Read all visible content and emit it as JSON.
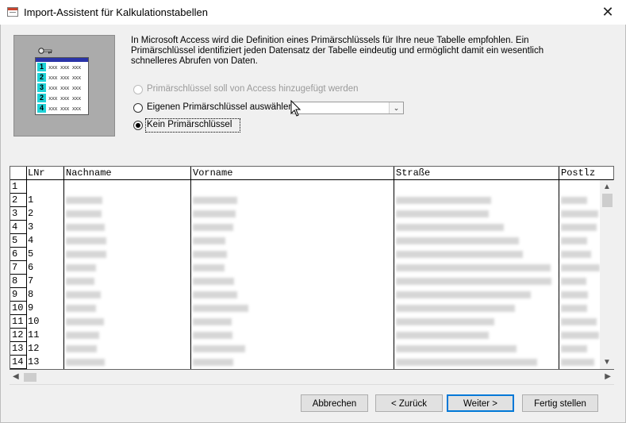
{
  "window": {
    "title": "Import-Assistent für Kalkulationstabellen",
    "close_glyph": "✕"
  },
  "illustration": {
    "row_numbers": [
      "1",
      "2",
      "3",
      "2",
      "4"
    ],
    "cell_text": "xxx xxx xxx"
  },
  "description": "In Microsoft Access wird die Definition eines Primärschlüssels für Ihre neue Tabelle empfohlen. Ein Primärschlüssel identifiziert jeden Datensatz der Tabelle eindeutig und ermöglicht damit ein wesentlich schnelleres Abrufen von Daten.",
  "options": {
    "access_key": {
      "label": "Primärschlüssel soll von Access hinzugefügt werden",
      "enabled": false,
      "selected": false
    },
    "own_key": {
      "label": "Eigenen Primärschlüssel auswählen",
      "enabled": true,
      "selected": false,
      "combo_value": ""
    },
    "no_key": {
      "label": "Kein Primärschlüssel",
      "enabled": true,
      "selected": true
    }
  },
  "grid": {
    "headers": [
      "LNr",
      "Nachname",
      "Vorname",
      "Straße",
      "Postlz"
    ],
    "row_numbers": [
      "1",
      "2",
      "3",
      "4",
      "5",
      "6",
      "7",
      "8",
      "9",
      "10",
      "11",
      "12",
      "13",
      "14"
    ],
    "lnr_values": [
      "",
      "1",
      "2",
      "3",
      "4",
      "5",
      "6",
      "7",
      "8",
      "9",
      "10",
      "11",
      "12",
      "13"
    ]
  },
  "buttons": {
    "cancel": "Abbrechen",
    "back": "< Zurück",
    "next": "Weiter >",
    "finish": "Fertig stellen"
  },
  "icons": {
    "key": "key-icon",
    "dropdown": "chevron-down-icon",
    "scroll_up": "▲",
    "scroll_down": "▼",
    "scroll_left": "◀",
    "scroll_right": "▶"
  }
}
